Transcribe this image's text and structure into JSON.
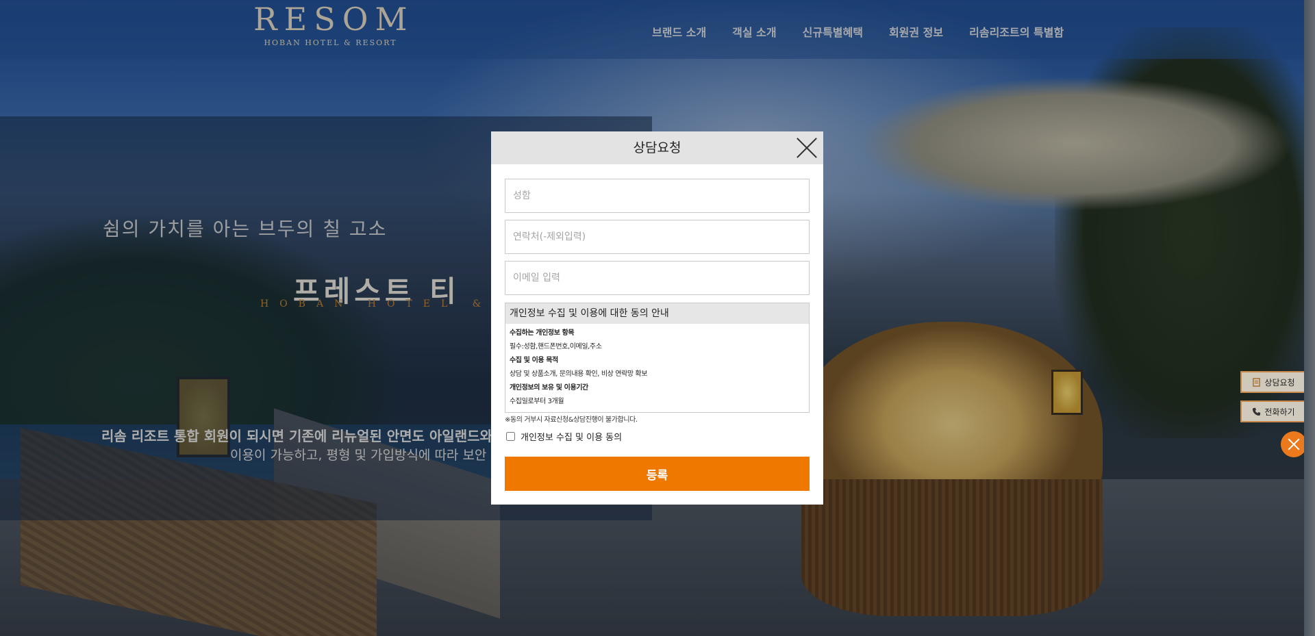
{
  "header": {
    "logo_main": "RESOM",
    "logo_sub": "HOBAN HOTEL & RESORT",
    "nav": [
      {
        "label": "브랜드 소개"
      },
      {
        "label": "객실 소개"
      },
      {
        "label": "신규특별혜택"
      },
      {
        "label": "회원권 정보"
      },
      {
        "label": "리솜리조트의 특별함"
      }
    ]
  },
  "hero": {
    "subtitle": "쉼의 가치를 아는  브두의 칠  고소",
    "title": "프레스트 티",
    "eng": "HOBAN HOTEL & R",
    "desc_line1": "리솜 리조트 통합 회원이 되시면 기존에 리뉴얼된 안면도 아일랜드와 덕",
    "desc_line2": "이용이 가능하고, 평형 및 가입방식에 따라 보안"
  },
  "modal": {
    "title": "상담요청",
    "name_placeholder": "성함",
    "phone_placeholder": "연락처(-제외입력)",
    "email_placeholder": "이메일 입력",
    "privacy": {
      "heading": "개인정보 수집 및 이용에 대한 동의 안내",
      "items_title": "수집하는 개인정보 항목",
      "items_text": "필수:성함,핸드폰번호,이메일,주소",
      "purpose_title": "수집 및 이용 목적",
      "purpose_text": "상담 및 상품소개, 문의내용 확인, 비상 연락망 확보",
      "period_title": "개인정보의 보유 및 이용기간",
      "period_text": "수집일로부터 3개월"
    },
    "notice": "※동의 거부시 자료신청&상담진행이 불가합니다.",
    "agree_label": "개인정보 수집 및 이용 동의",
    "agree_checked": false,
    "submit_label": "등록"
  },
  "side": {
    "consult_label": "상담요청",
    "call_label": "전화하기"
  },
  "colors": {
    "accent": "#ee7800",
    "side_border": "#c7884a",
    "close_circle": "#ec7a1c"
  }
}
